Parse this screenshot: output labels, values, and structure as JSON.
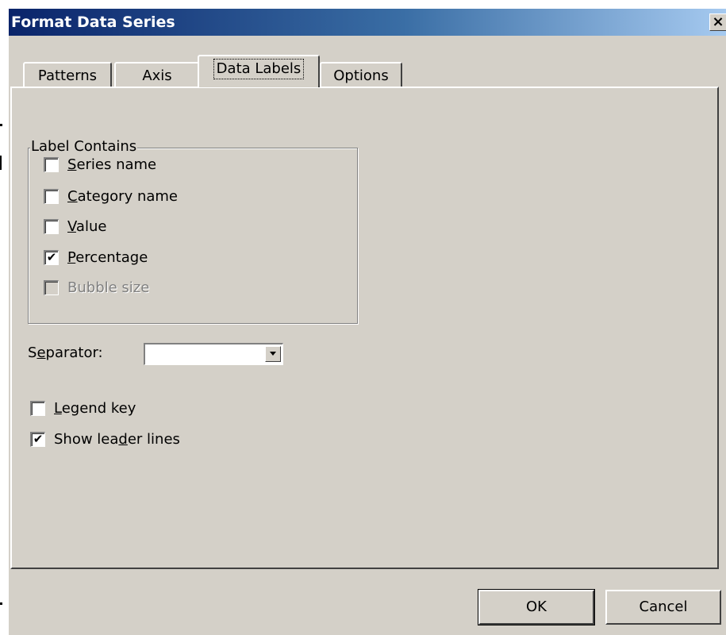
{
  "window": {
    "title": "Format Data Series",
    "close_label": "x"
  },
  "tabs": [
    {
      "label": "Patterns",
      "active": false
    },
    {
      "label": "Axis",
      "active": false
    },
    {
      "label": "Data Labels",
      "active": true
    },
    {
      "label": "Options",
      "active": false
    }
  ],
  "label_contains": {
    "legend": "Label Contains",
    "items": [
      {
        "label_mnemonic": "S",
        "label_rest": "eries name",
        "checked": false,
        "enabled": true
      },
      {
        "label_mnemonic": "C",
        "label_rest": "ategory name",
        "checked": false,
        "enabled": true
      },
      {
        "label_mnemonic": "V",
        "label_rest": "alue",
        "checked": false,
        "enabled": true
      },
      {
        "label_mnemonic": "P",
        "label_rest": "ercentage",
        "checked": true,
        "enabled": true
      },
      {
        "label_mnemonic": "B",
        "label_rest": "ubble size",
        "checked": false,
        "enabled": false
      }
    ]
  },
  "separator": {
    "label_pre": "S",
    "label_mnemonic": "e",
    "label_post": "parator:",
    "value": ""
  },
  "legend_key": {
    "label_mnemonic": "L",
    "label_rest": "egend key",
    "checked": false
  },
  "leader_lines": {
    "label_pre": "Show lea",
    "label_mnemonic": "d",
    "label_post": "er lines",
    "checked": true
  },
  "buttons": {
    "ok": "OK",
    "cancel": "Cancel"
  },
  "check_glyph": "✔",
  "colors": {
    "face": "#d4d0c8",
    "title_start": "#0a246a",
    "title_end": "#a6caf0"
  }
}
